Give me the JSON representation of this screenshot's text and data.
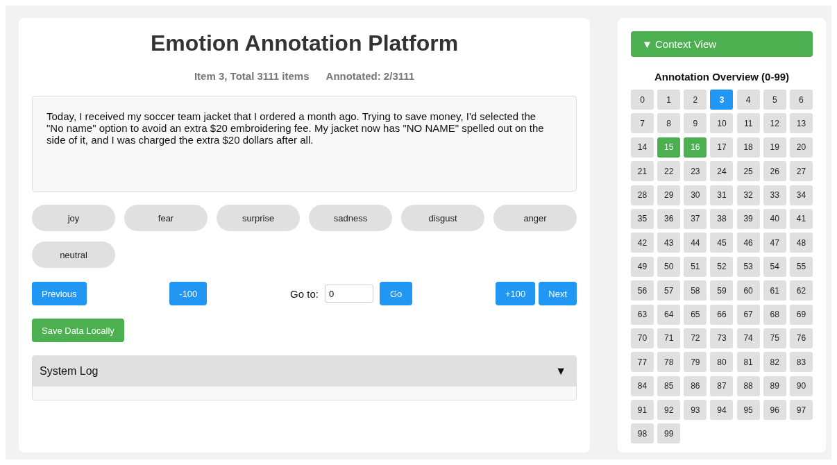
{
  "title": "Emotion Annotation Platform",
  "stats": [
    "Item 3, Total 3111 items",
    "Annotated: 2/3111"
  ],
  "text": "Today, I received my soccer team jacket that I ordered a month ago. Trying to save money, I'd selected the \"No name\" option to avoid an extra $20 embroidering fee. My jacket now has \"NO NAME\" spelled out on the side of it, and I was charged the extra $20 dollars after all.",
  "emotions": [
    {
      "label": "joy",
      "selected": false
    },
    {
      "label": "fear",
      "selected": false
    },
    {
      "label": "surprise",
      "selected": false
    },
    {
      "label": "sadness",
      "selected": false
    },
    {
      "label": "disgust",
      "selected": false
    },
    {
      "label": "anger",
      "selected": false
    },
    {
      "label": "neutral",
      "selected": false
    }
  ],
  "navigation": {
    "previous": "Previous",
    "back_100": "-100",
    "goto_label": "Go to:",
    "goto_value": "0",
    "go": "Go",
    "forward_100": "+100",
    "next": "Next"
  },
  "save_button": "Save Data Locally",
  "system_log": {
    "title": "System Log",
    "toggle_icon": "▼"
  },
  "context_view": {
    "toggle_icon": "▼",
    "label": "Context View"
  },
  "overview": {
    "title": "Annotation Overview (0-99)",
    "cells": [
      {
        "label": "0",
        "selected": false,
        "annotated": false
      },
      {
        "label": "1",
        "selected": false,
        "annotated": false
      },
      {
        "label": "2",
        "selected": false,
        "annotated": false
      },
      {
        "label": "3",
        "selected": true,
        "annotated": false
      },
      {
        "label": "4",
        "selected": false,
        "annotated": false
      },
      {
        "label": "5",
        "selected": false,
        "annotated": false
      },
      {
        "label": "6",
        "selected": false,
        "annotated": false
      },
      {
        "label": "7",
        "selected": false,
        "annotated": false
      },
      {
        "label": "8",
        "selected": false,
        "annotated": false
      },
      {
        "label": "9",
        "selected": false,
        "annotated": false
      },
      {
        "label": "10",
        "selected": false,
        "annotated": false
      },
      {
        "label": "11",
        "selected": false,
        "annotated": false
      },
      {
        "label": "12",
        "selected": false,
        "annotated": false
      },
      {
        "label": "13",
        "selected": false,
        "annotated": false
      },
      {
        "label": "14",
        "selected": false,
        "annotated": false
      },
      {
        "label": "15",
        "selected": false,
        "annotated": true
      },
      {
        "label": "16",
        "selected": false,
        "annotated": true
      },
      {
        "label": "17",
        "selected": false,
        "annotated": false
      },
      {
        "label": "18",
        "selected": false,
        "annotated": false
      },
      {
        "label": "19",
        "selected": false,
        "annotated": false
      },
      {
        "label": "20",
        "selected": false,
        "annotated": false
      },
      {
        "label": "21",
        "selected": false,
        "annotated": false
      },
      {
        "label": "22",
        "selected": false,
        "annotated": false
      },
      {
        "label": "23",
        "selected": false,
        "annotated": false
      },
      {
        "label": "24",
        "selected": false,
        "annotated": false
      },
      {
        "label": "25",
        "selected": false,
        "annotated": false
      },
      {
        "label": "26",
        "selected": false,
        "annotated": false
      },
      {
        "label": "27",
        "selected": false,
        "annotated": false
      },
      {
        "label": "28",
        "selected": false,
        "annotated": false
      },
      {
        "label": "29",
        "selected": false,
        "annotated": false
      },
      {
        "label": "30",
        "selected": false,
        "annotated": false
      },
      {
        "label": "31",
        "selected": false,
        "annotated": false
      },
      {
        "label": "32",
        "selected": false,
        "annotated": false
      },
      {
        "label": "33",
        "selected": false,
        "annotated": false
      },
      {
        "label": "34",
        "selected": false,
        "annotated": false
      },
      {
        "label": "35",
        "selected": false,
        "annotated": false
      },
      {
        "label": "36",
        "selected": false,
        "annotated": false
      },
      {
        "label": "37",
        "selected": false,
        "annotated": false
      },
      {
        "label": "38",
        "selected": false,
        "annotated": false
      },
      {
        "label": "39",
        "selected": false,
        "annotated": false
      },
      {
        "label": "40",
        "selected": false,
        "annotated": false
      },
      {
        "label": "41",
        "selected": false,
        "annotated": false
      },
      {
        "label": "42",
        "selected": false,
        "annotated": false
      },
      {
        "label": "43",
        "selected": false,
        "annotated": false
      },
      {
        "label": "44",
        "selected": false,
        "annotated": false
      },
      {
        "label": "45",
        "selected": false,
        "annotated": false
      },
      {
        "label": "46",
        "selected": false,
        "annotated": false
      },
      {
        "label": "47",
        "selected": false,
        "annotated": false
      },
      {
        "label": "48",
        "selected": false,
        "annotated": false
      },
      {
        "label": "49",
        "selected": false,
        "annotated": false
      },
      {
        "label": "50",
        "selected": false,
        "annotated": false
      },
      {
        "label": "51",
        "selected": false,
        "annotated": false
      },
      {
        "label": "52",
        "selected": false,
        "annotated": false
      },
      {
        "label": "53",
        "selected": false,
        "annotated": false
      },
      {
        "label": "54",
        "selected": false,
        "annotated": false
      },
      {
        "label": "55",
        "selected": false,
        "annotated": false
      },
      {
        "label": "56",
        "selected": false,
        "annotated": false
      },
      {
        "label": "57",
        "selected": false,
        "annotated": false
      },
      {
        "label": "58",
        "selected": false,
        "annotated": false
      },
      {
        "label": "59",
        "selected": false,
        "annotated": false
      },
      {
        "label": "60",
        "selected": false,
        "annotated": false
      },
      {
        "label": "61",
        "selected": false,
        "annotated": false
      },
      {
        "label": "62",
        "selected": false,
        "annotated": false
      },
      {
        "label": "63",
        "selected": false,
        "annotated": false
      },
      {
        "label": "64",
        "selected": false,
        "annotated": false
      },
      {
        "label": "65",
        "selected": false,
        "annotated": false
      },
      {
        "label": "66",
        "selected": false,
        "annotated": false
      },
      {
        "label": "67",
        "selected": false,
        "annotated": false
      },
      {
        "label": "68",
        "selected": false,
        "annotated": false
      },
      {
        "label": "69",
        "selected": false,
        "annotated": false
      },
      {
        "label": "70",
        "selected": false,
        "annotated": false
      },
      {
        "label": "71",
        "selected": false,
        "annotated": false
      },
      {
        "label": "72",
        "selected": false,
        "annotated": false
      },
      {
        "label": "73",
        "selected": false,
        "annotated": false
      },
      {
        "label": "74",
        "selected": false,
        "annotated": false
      },
      {
        "label": "75",
        "selected": false,
        "annotated": false
      },
      {
        "label": "76",
        "selected": false,
        "annotated": false
      },
      {
        "label": "77",
        "selected": false,
        "annotated": false
      },
      {
        "label": "78",
        "selected": false,
        "annotated": false
      },
      {
        "label": "79",
        "selected": false,
        "annotated": false
      },
      {
        "label": "80",
        "selected": false,
        "annotated": false
      },
      {
        "label": "81",
        "selected": false,
        "annotated": false
      },
      {
        "label": "82",
        "selected": false,
        "annotated": false
      },
      {
        "label": "83",
        "selected": false,
        "annotated": false
      },
      {
        "label": "84",
        "selected": false,
        "annotated": false
      },
      {
        "label": "85",
        "selected": false,
        "annotated": false
      },
      {
        "label": "86",
        "selected": false,
        "annotated": false
      },
      {
        "label": "87",
        "selected": false,
        "annotated": false
      },
      {
        "label": "88",
        "selected": false,
        "annotated": false
      },
      {
        "label": "89",
        "selected": false,
        "annotated": false
      },
      {
        "label": "90",
        "selected": false,
        "annotated": false
      },
      {
        "label": "91",
        "selected": false,
        "annotated": false
      },
      {
        "label": "92",
        "selected": false,
        "annotated": false
      },
      {
        "label": "93",
        "selected": false,
        "annotated": false
      },
      {
        "label": "94",
        "selected": false,
        "annotated": false
      },
      {
        "label": "95",
        "selected": false,
        "annotated": false
      },
      {
        "label": "96",
        "selected": false,
        "annotated": false
      },
      {
        "label": "97",
        "selected": false,
        "annotated": false
      },
      {
        "label": "98",
        "selected": false,
        "annotated": false
      },
      {
        "label": "99",
        "selected": false,
        "annotated": false
      }
    ]
  }
}
